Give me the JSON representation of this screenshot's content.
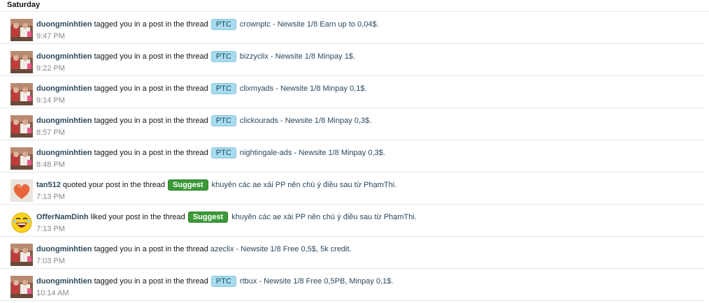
{
  "day_label": "Saturday",
  "colors": {
    "ptc_prefix_bg": "#a8dbef",
    "suggest_prefix_bg": "#3b9a37",
    "username": "#2b485c",
    "timestamp": "#8a8a8a"
  },
  "items": [
    {
      "user": "duongminhtien",
      "avatar": "photo-avatar",
      "action": "tagged you in a post in the thread",
      "prefix": "PTC",
      "title": "crownptc - Newsite 1/8 Earn up to 0,04$.",
      "time": "9:47 PM"
    },
    {
      "user": "duongminhtien",
      "avatar": "photo-avatar",
      "action": "tagged you in a post in the thread",
      "prefix": "PTC",
      "title": "bizzyclix - Newsite 1/8 Minpay 1$.",
      "time": "9:22 PM"
    },
    {
      "user": "duongminhtien",
      "avatar": "photo-avatar",
      "action": "tagged you in a post in the thread",
      "prefix": "PTC",
      "title": "clixmyads - Newsite 1/8 Minpay 0,1$.",
      "time": "9:14 PM"
    },
    {
      "user": "duongminhtien",
      "avatar": "photo-avatar",
      "action": "tagged you in a post in the thread",
      "prefix": "PTC",
      "title": "clickourads - Newsite 1/8 Minpay 0,3$.",
      "time": "8:57 PM"
    },
    {
      "user": "duongminhtien",
      "avatar": "photo-avatar",
      "action": "tagged you in a post in the thread",
      "prefix": "PTC",
      "title": "nightingale-ads - Newsite 1/8 Minpay 0,3$.",
      "time": "8:48 PM"
    },
    {
      "user": "tan512",
      "avatar": "heart-avatar",
      "action": "quoted your post in the thread",
      "prefix": "Suggest",
      "title": "khuyên các ae xài PP nên chú ý điều sau từ PhạmThi.",
      "time": "7:13 PM"
    },
    {
      "user": "OfferNamDinh",
      "avatar": "laughing-smiley-avatar",
      "action": "liked your post in the thread",
      "prefix": "Suggest",
      "title": "khuyên các ae xài PP nên chú ý điều sau từ PhạmThi.",
      "time": "7:13 PM"
    },
    {
      "user": "duongminhtien",
      "avatar": "photo-avatar",
      "action": "tagged you in a post in the thread",
      "prefix": "",
      "title": "azeclix - Newsite 1/8 Free 0,5$, 5k credit.",
      "time": "7:03 PM"
    },
    {
      "user": "duongminhtien",
      "avatar": "photo-avatar",
      "action": "tagged you in a post in the thread",
      "prefix": "PTC",
      "title": "rtbux - Newsite 1/8 Free 0,5PB, Minpay 0,1$.",
      "time": "10:14 AM"
    }
  ]
}
